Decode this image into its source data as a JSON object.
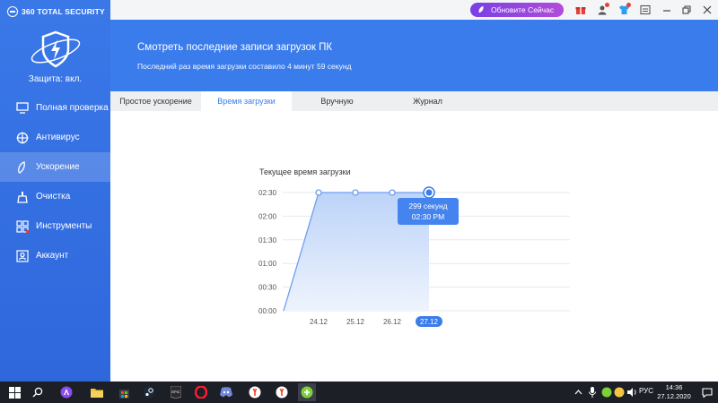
{
  "app": {
    "brand": "360 TOTAL SECURITY"
  },
  "sidebar": {
    "protection": "Защита: вкл.",
    "items": [
      {
        "label": "Полная проверка",
        "icon": "monitor-icon"
      },
      {
        "label": "Антивирус",
        "icon": "antivirus-icon"
      },
      {
        "label": "Ускорение",
        "icon": "rocket-icon",
        "active": true
      },
      {
        "label": "Очистка",
        "icon": "brush-icon"
      },
      {
        "label": "Инструменты",
        "icon": "grid-icon"
      },
      {
        "label": "Аккаунт",
        "icon": "user-icon"
      }
    ]
  },
  "topbar": {
    "update_label": "Обновите Сейчас"
  },
  "header": {
    "title": "Смотреть последние записи загрузок ПК",
    "subtitle": "Последний раз время загрузки составило 4 минут 59 секунд"
  },
  "tabs": [
    {
      "label": "Простое ускорение"
    },
    {
      "label": "Время загрузки",
      "active": true
    },
    {
      "label": "Вручную"
    },
    {
      "label": "Журнал"
    }
  ],
  "chart_data": {
    "type": "area",
    "title": "Текущее время загрузки",
    "y_ticks": [
      "00:00",
      "00:30",
      "01:00",
      "01:30",
      "02:00",
      "02:30"
    ],
    "ylim": [
      0,
      150
    ],
    "categories": [
      "24.12",
      "25.12",
      "26.12",
      "27.12"
    ],
    "values": [
      150,
      150,
      150,
      150
    ],
    "start_value": 0,
    "highlight_index": 3,
    "tooltip": {
      "line1": "299 секунд",
      "line2": "02:30 PM"
    },
    "colors": {
      "line": "#6f9ef0",
      "fill_top": "#bcd3f8",
      "fill_bottom": "#eef4fd",
      "accent": "#3a7cec"
    },
    "grid": true
  },
  "taskbar": {
    "lang": "РУС",
    "time": "14:36",
    "date": "27.12.2020"
  }
}
